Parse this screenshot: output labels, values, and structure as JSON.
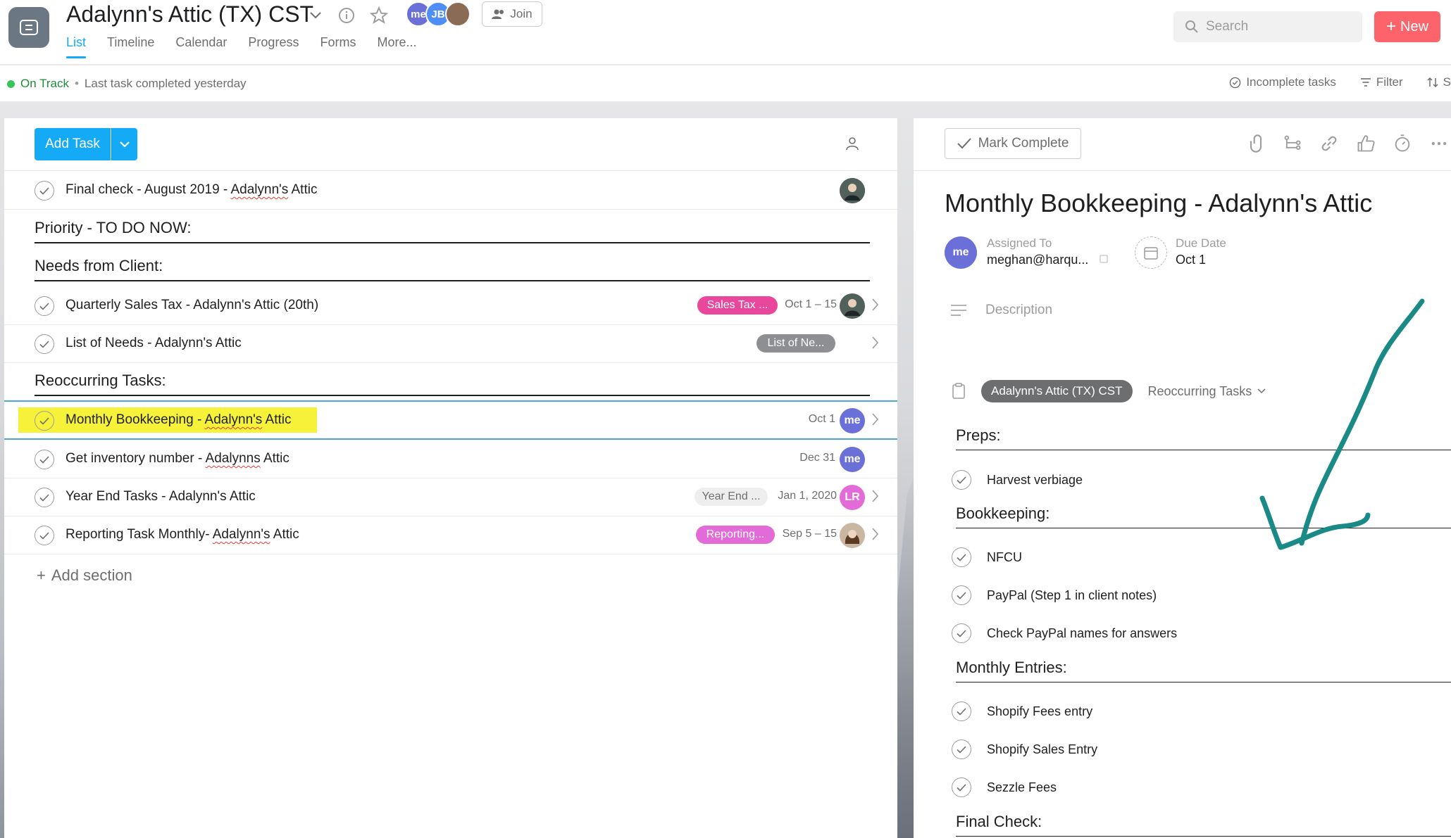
{
  "header": {
    "project_title": "Adalynn's Attic (TX) CST",
    "tabs": [
      "List",
      "Timeline",
      "Calendar",
      "Progress",
      "Forms",
      "More..."
    ],
    "members": [
      {
        "initials": "me",
        "color": "#6b6fd8"
      },
      {
        "initials": "JB",
        "color": "#4f8ef7"
      },
      {
        "initials": "",
        "color": "#8a6b55"
      }
    ],
    "join_label": "Join",
    "search_placeholder": "Search",
    "new_label": "New"
  },
  "status": {
    "state": "On Track",
    "separator": "•",
    "message": "Last task completed yesterday",
    "incomplete_label": "Incomplete tasks",
    "filter_label": "Filter",
    "sort_label": "S"
  },
  "list": {
    "add_task_label": "Add Task",
    "add_section_label": "Add section",
    "top_task": {
      "name": "Final check - August 2019 - ",
      "name_link": "Adalynn's",
      "name_suffix": " Attic"
    },
    "sections": [
      {
        "title": "Priority - TO DO NOW:"
      },
      {
        "title": "Needs from Client:"
      },
      {
        "title": "Reoccurring Tasks:"
      }
    ],
    "needs_tasks": [
      {
        "name": "Quarterly Sales Tax - Adalynn's Attic  (20th)",
        "tag": "Sales Tax ...",
        "tag_color": "#e8479b",
        "date": "Oct 1 – 15"
      },
      {
        "name": "List of Needs - Adalynn's Attic",
        "tag": "List of Ne...",
        "tag_color": "#8d8f92",
        "date": ""
      }
    ],
    "recurring_tasks": [
      {
        "name_pre": "Monthly Bookkeeping - ",
        "name_link": "Adalynn's",
        "name_suffix": " Attic",
        "date": "Oct 1",
        "assignee": "me",
        "assignee_color": "#6b6fd8"
      },
      {
        "name_pre": "Get inventory number - ",
        "name_link": "Adalynns",
        "name_suffix": " Attic",
        "date": "Dec 31",
        "assignee": "me",
        "assignee_color": "#6b6fd8"
      },
      {
        "name_pre": "Year End Tasks - Adalynn's Attic",
        "name_link": "",
        "name_suffix": "",
        "tag": "Year End ...",
        "tag_color": "#eeeeef",
        "date": "Jan 1, 2020",
        "assignee": "LR",
        "assignee_color": "#e36bd8"
      },
      {
        "name_pre": "Reporting Task Monthly- ",
        "name_link": "Adalynn's",
        "name_suffix": " Attic",
        "tag": "Reporting...",
        "tag_color": "#e36bd8",
        "date": "Sep 5 – 15",
        "assignee": "",
        "assignee_color": "#8a6b55"
      }
    ]
  },
  "detail": {
    "mark_complete_label": "Mark Complete",
    "title": "Monthly Bookkeeping - Adalynn's Attic",
    "assigned_label": "Assigned To",
    "assigned_avatar": "me",
    "assigned_value": "meghan@harqu...",
    "due_label": "Due Date",
    "due_value": "Oct 1",
    "description_placeholder": "Description",
    "project_pill": "Adalynn's Attic (TX) CST",
    "section_select": "Reoccurring Tasks",
    "subsections": [
      {
        "title": "Preps:",
        "items": [
          "Harvest verbiage"
        ]
      },
      {
        "title": "Bookkeeping:",
        "items": [
          "NFCU",
          "PayPal (Step 1 in client notes)",
          "Check PayPal names for answers"
        ]
      },
      {
        "title": "Monthly Entries:",
        "items": [
          "Shopify Fees entry",
          "Shopify Sales Entry",
          "Sezzle Fees"
        ]
      },
      {
        "title": "Final Check:",
        "items": []
      }
    ]
  },
  "colors": {
    "accent": "#14aaf5",
    "new_button": "#fc636b",
    "highlight": "#f6f23a",
    "annotation": "#1a8a86"
  }
}
